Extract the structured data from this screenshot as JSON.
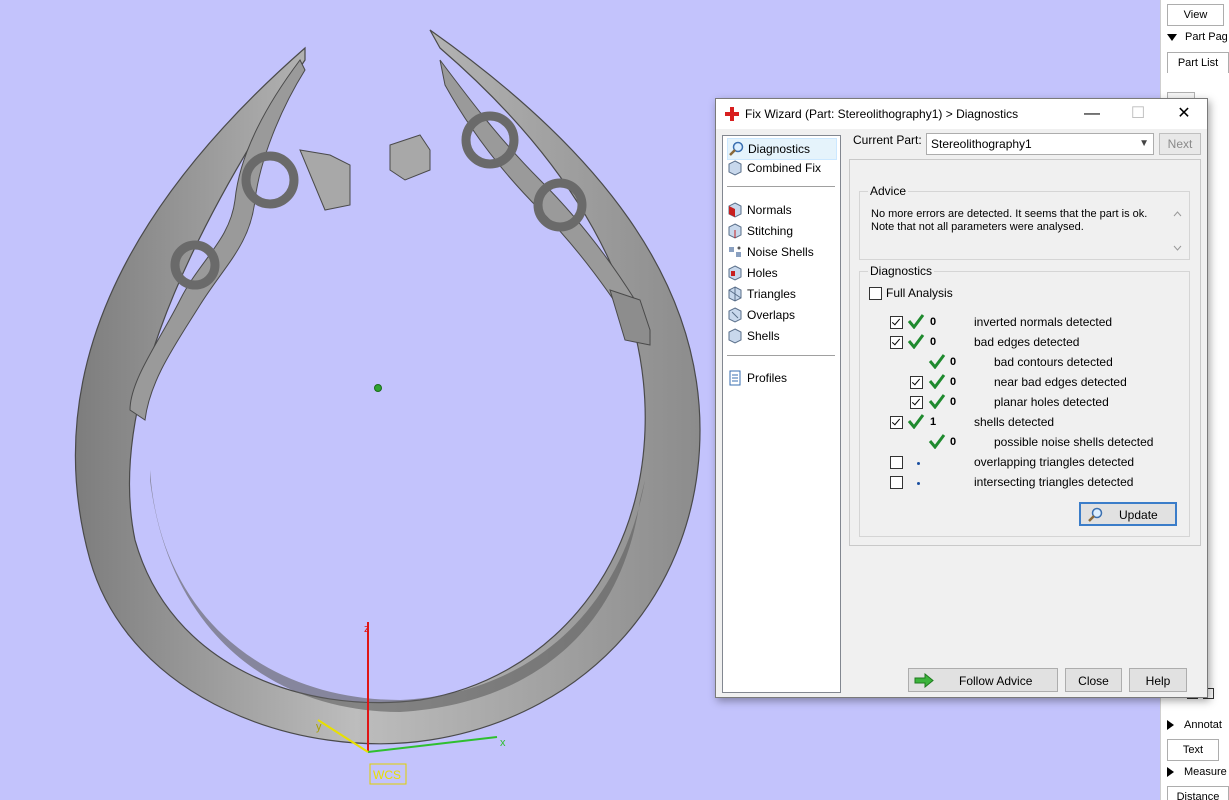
{
  "viewport": {
    "background": "#c3c3fc",
    "axis_labels": {
      "z": "z",
      "y": "y",
      "x": "x"
    },
    "wcs_label": "WCS"
  },
  "side_panel": {
    "view_btn": "View",
    "part_pages": "Part Pag",
    "part_list": "Part List",
    "annotations": "Annotat",
    "text_btn": "Text",
    "measure": "Measure",
    "distance": "Distance"
  },
  "dialog": {
    "title": "Fix Wizard (Part: Stereolithography1) > Diagnostics",
    "controls": {
      "minimize": "—",
      "maximize": "☐",
      "close": "✕"
    },
    "nav": {
      "diagnostics": "Diagnostics",
      "combined_fix": "Combined Fix",
      "normals": "Normals",
      "stitching": "Stitching",
      "noise_shells": "Noise Shells",
      "holes": "Holes",
      "triangles": "Triangles",
      "overlaps": "Overlaps",
      "shells": "Shells",
      "profiles": "Profiles"
    },
    "current_part_label": "Current Part:",
    "current_part_value": "Stereolithography1",
    "next_label": "Next",
    "advice": {
      "label": "Advice",
      "text_line1": "No more errors are detected. It seems that the part is ok.",
      "text_line2": "Note that not all parameters were analysed."
    },
    "diagnostics": {
      "label": "Diagnostics",
      "full_analysis": "Full Analysis",
      "rows": [
        {
          "count": "0",
          "label": "inverted normals detected"
        },
        {
          "count": "0",
          "label": "bad edges detected"
        },
        {
          "count": "0",
          "label": "bad contours detected"
        },
        {
          "count": "0",
          "label": "near bad edges detected"
        },
        {
          "count": "0",
          "label": "planar holes detected"
        },
        {
          "count": "1",
          "label": "shells detected"
        },
        {
          "count": "0",
          "label": "possible noise shells detected"
        },
        {
          "count": "",
          "label": "overlapping triangles detected"
        },
        {
          "count": "",
          "label": "intersecting triangles detected"
        }
      ]
    },
    "update_label": "Update",
    "follow_advice_label": "Follow Advice",
    "close_label": "Close",
    "help_label": "Help"
  }
}
